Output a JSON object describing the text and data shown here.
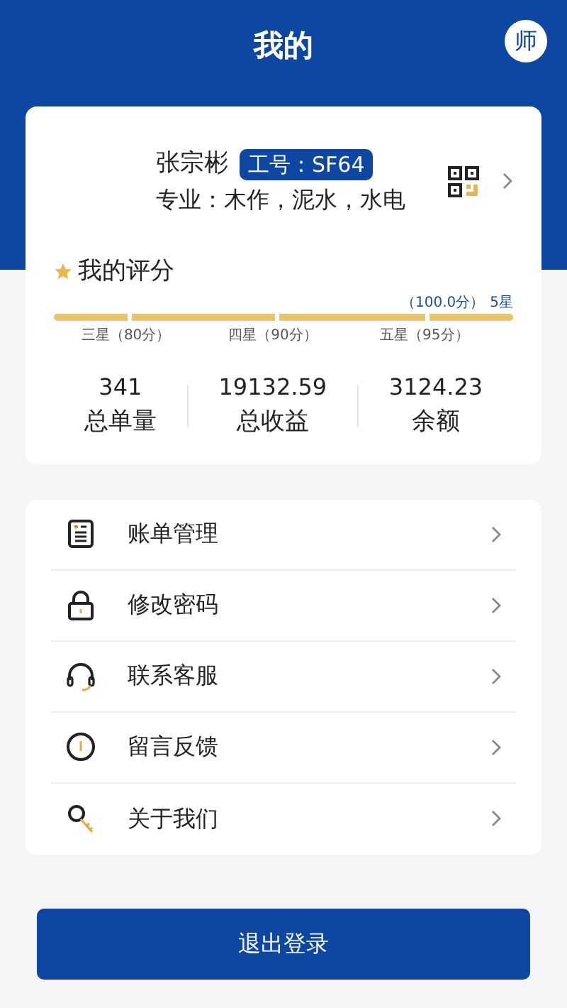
{
  "header": {
    "title": "我的",
    "avatar_text": "师"
  },
  "profile": {
    "name": "张宗彬",
    "badge": "工号：SF64",
    "specialty": "专业：木作，泥水，水电"
  },
  "rating": {
    "title": "我的评分",
    "score": "（100.0分）",
    "stars_text": "5星",
    "level": 1.0,
    "marks": [
      "三星（80分）",
      "四星（90分）",
      "五星（95分）"
    ]
  },
  "stats": [
    {
      "value": "341",
      "label": "总单量"
    },
    {
      "value": "19132.59",
      "label": "总收益"
    },
    {
      "value": "3124.23",
      "label": "余额"
    }
  ],
  "menu": [
    {
      "label": "账单管理"
    },
    {
      "label": "修改密码"
    },
    {
      "label": "联系客服"
    },
    {
      "label": "留言反馈"
    },
    {
      "label": "关于我们"
    }
  ],
  "logout": {
    "label": "退出登录"
  }
}
